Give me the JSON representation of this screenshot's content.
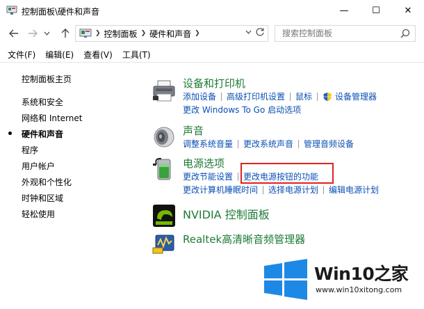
{
  "window": {
    "title": "控制面板\\硬件和声音",
    "minimize_glyph": "—",
    "maximize_glyph": "☐",
    "close_glyph": "✕"
  },
  "address": {
    "crumbs": [
      "控制面板",
      "硬件和声音"
    ],
    "search_placeholder": "搜索控制面板"
  },
  "menu": {
    "items": [
      "文件(F)",
      "编辑(E)",
      "查看(V)",
      "工具(T)"
    ]
  },
  "leftnav": {
    "items": [
      "控制面板主页",
      "系统和安全",
      "网络和 Internet",
      "硬件和声音",
      "程序",
      "用户帐户",
      "外观和个性化",
      "时钟和区域",
      "轻松使用"
    ],
    "current_index": 3
  },
  "categories": {
    "devices": {
      "title": "设备和打印机",
      "links_row1": [
        "添加设备",
        "高级打印机设置",
        "鼠标",
        "设备管理器"
      ],
      "links_row2": [
        "更改 Windows To Go 启动选项"
      ]
    },
    "sound": {
      "title": "声音",
      "links_row1": [
        "调整系统音量",
        "更改系统声音",
        "管理音频设备"
      ]
    },
    "power": {
      "title": "电源选项",
      "links_row1": [
        "更改节能设置",
        "更改电源按钮的功能"
      ],
      "links_row2": [
        "更改计算机睡眠时间",
        "选择电源计划",
        "编辑电源计划"
      ]
    },
    "nvidia": {
      "title": "NVIDIA 控制面板"
    },
    "realtek": {
      "title": "Realtek高清晰音频管理器"
    }
  },
  "watermark": {
    "brand": "Win10之家",
    "url": "www.win10xitong.com"
  },
  "colors": {
    "category_title": "#1e7a35",
    "link": "#0a4fb4",
    "highlight": "#e02020",
    "win_blue": "#1e88e5"
  }
}
